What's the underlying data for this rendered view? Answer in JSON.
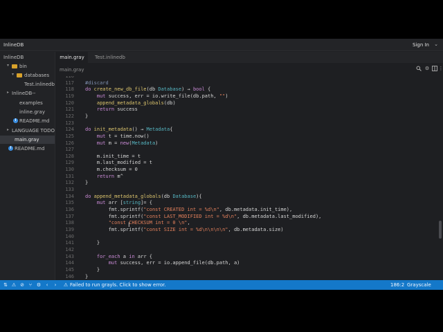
{
  "window": {
    "title": "InlineDB",
    "signin": "Sign In"
  },
  "sidebar": {
    "items": [
      {
        "label": "InlineDB",
        "kind": "root",
        "depth": 0
      },
      {
        "label": "bin",
        "kind": "folder",
        "depth": 1
      },
      {
        "label": "databases",
        "kind": "folder",
        "depth": 2
      },
      {
        "label": "Test.inlinedb",
        "kind": "file",
        "depth": 3
      },
      {
        "label": "InlineDB--",
        "kind": "folder-collapsed",
        "depth": 1
      },
      {
        "label": "examples",
        "kind": "file",
        "depth": 2
      },
      {
        "label": "inline.gray",
        "kind": "file",
        "depth": 2
      },
      {
        "label": "README.md",
        "kind": "info",
        "depth": 2
      },
      {
        "label": "LANGUAGE TODO",
        "kind": "folder-collapsed",
        "depth": 1
      },
      {
        "label": "main.gray",
        "kind": "file",
        "depth": 1,
        "selected": true
      },
      {
        "label": "README.md",
        "kind": "info",
        "depth": 1
      }
    ]
  },
  "tabs": [
    {
      "label": "main.gray",
      "active": true
    },
    {
      "label": "Test.inlinedb",
      "active": false
    }
  ],
  "path": "main.gray",
  "toolbar_icons": [
    "search-icon",
    "settings-icon",
    "split-editor-icon",
    "more-icon"
  ],
  "editor": {
    "lines": [
      {
        "n": "116",
        "tokens": []
      },
      {
        "n": "117",
        "tokens": [
          [
            "cm",
            "#discard"
          ]
        ]
      },
      {
        "n": "118",
        "tokens": [
          [
            "kw",
            "do "
          ],
          [
            "fn",
            "create_new_db_file"
          ],
          [
            "",
            "(db "
          ],
          [
            "ty",
            "Database"
          ],
          [
            "",
            ") → "
          ],
          [
            "kw",
            "bool"
          ],
          [
            "",
            " {"
          ]
        ]
      },
      {
        "n": "119",
        "tokens": [
          [
            "",
            "    "
          ],
          [
            "kw",
            "mut "
          ],
          [
            "",
            "success, err = io.write_file(db.path, "
          ],
          [
            "str",
            "\"\""
          ],
          [
            "",
            ")"
          ]
        ]
      },
      {
        "n": "120",
        "tokens": [
          [
            "",
            "    "
          ],
          [
            "fn",
            "append_metadata_globals"
          ],
          [
            "",
            "(db)"
          ]
        ]
      },
      {
        "n": "121",
        "tokens": [
          [
            "",
            "    "
          ],
          [
            "kw",
            "return "
          ],
          [
            "",
            "success"
          ]
        ]
      },
      {
        "n": "122",
        "tokens": [
          [
            "",
            "}"
          ]
        ]
      },
      {
        "n": "123",
        "tokens": []
      },
      {
        "n": "124",
        "tokens": [
          [
            "kw",
            "do "
          ],
          [
            "fn",
            "init_metadata"
          ],
          [
            "",
            "() → "
          ],
          [
            "ty",
            "Metadata"
          ],
          [
            "",
            "{"
          ]
        ]
      },
      {
        "n": "125",
        "tokens": [
          [
            "",
            "    "
          ],
          [
            "kw",
            "mut "
          ],
          [
            "",
            "t = time.now()"
          ]
        ]
      },
      {
        "n": "126",
        "tokens": [
          [
            "",
            "    "
          ],
          [
            "kw",
            "mut "
          ],
          [
            "",
            "m = "
          ],
          [
            "kw",
            "new"
          ],
          [
            "",
            "("
          ],
          [
            "ty",
            "Metadata"
          ],
          [
            "",
            ")"
          ]
        ]
      },
      {
        "n": "127",
        "tokens": []
      },
      {
        "n": "128",
        "tokens": [
          [
            "",
            "    m.init_time = t"
          ]
        ]
      },
      {
        "n": "129",
        "tokens": [
          [
            "",
            "    m.last_modified = t"
          ]
        ]
      },
      {
        "n": "130",
        "tokens": [
          [
            "",
            "    m.checksum = 0"
          ]
        ]
      },
      {
        "n": "131",
        "tokens": [
          [
            "",
            "    "
          ],
          [
            "kw",
            "return "
          ],
          [
            "",
            "m^"
          ]
        ]
      },
      {
        "n": "132",
        "tokens": [
          [
            "",
            "}"
          ]
        ]
      },
      {
        "n": "133",
        "tokens": []
      },
      {
        "n": "134",
        "tokens": [
          [
            "kw",
            "do "
          ],
          [
            "fn",
            "append_metadata_globals"
          ],
          [
            "",
            "(db "
          ],
          [
            "ty",
            "Database"
          ],
          [
            "",
            "){"
          ]
        ]
      },
      {
        "n": "135",
        "tokens": [
          [
            "",
            "    "
          ],
          [
            "kw",
            "mut "
          ],
          [
            "",
            "arr ["
          ],
          [
            "ty",
            "string"
          ],
          [
            "",
            "]= {"
          ]
        ]
      },
      {
        "n": "136",
        "tokens": [
          [
            "",
            "        fmt.sprintf("
          ],
          [
            "str",
            "\"const CREATED int = %d\\n\""
          ],
          [
            "",
            ", db.metadata.init_time),"
          ]
        ]
      },
      {
        "n": "137",
        "tokens": [
          [
            "",
            "        fmt.sprintf("
          ],
          [
            "str",
            "\"const LAST_MODIFIED int = %d\\n\""
          ],
          [
            "",
            ", db.metadata.last_modified),"
          ]
        ]
      },
      {
        "n": "138",
        "tokens": [
          [
            "",
            "        "
          ],
          [
            "str",
            "\"const CHECKSUM int = 0 \\n\""
          ],
          [
            "",
            ","
          ]
        ]
      },
      {
        "n": "139",
        "tokens": [
          [
            "",
            "        fmt.sprintf("
          ],
          [
            "str",
            "\"const SIZE int = %d\\n\\n\\n\\n\""
          ],
          [
            "",
            ", db.metadata.size)"
          ]
        ]
      },
      {
        "n": "140",
        "tokens": []
      },
      {
        "n": "141",
        "tokens": [
          [
            "",
            "    }"
          ]
        ]
      },
      {
        "n": "142",
        "tokens": []
      },
      {
        "n": "143",
        "tokens": [
          [
            "",
            "    "
          ],
          [
            "kw",
            "for_each "
          ],
          [
            "",
            "a "
          ],
          [
            "kw",
            "in "
          ],
          [
            "",
            "arr {"
          ]
        ]
      },
      {
        "n": "144",
        "tokens": [
          [
            "",
            "        "
          ],
          [
            "kw",
            "mut "
          ],
          [
            "",
            "success, err = io.append_file(db.path, a)"
          ]
        ]
      },
      {
        "n": "145",
        "tokens": [
          [
            "",
            "    }"
          ]
        ]
      },
      {
        "n": "146",
        "tokens": [
          [
            "",
            "}"
          ]
        ]
      }
    ]
  },
  "statusbar": {
    "icons": [
      "broadcast-icon",
      "warning-icon",
      "error-icon",
      "git-icon",
      "gear-icon",
      "chevron-icon",
      "error-badge-icon"
    ],
    "message": "Failed to run grayls. Click to show error.",
    "position": "186:2",
    "theme": "Grayscale"
  },
  "colors": {
    "accent": "#1478c9",
    "background": "#1e1f22",
    "folder": "#d9a22b"
  }
}
